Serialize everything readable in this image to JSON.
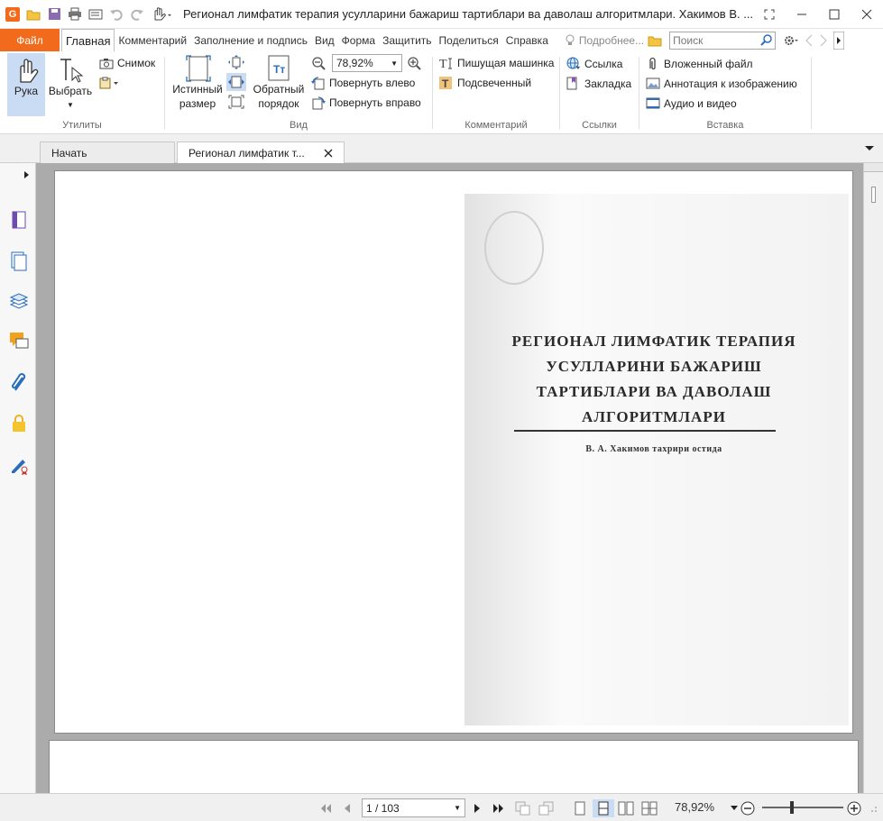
{
  "window": {
    "app_logo": "G",
    "title": "Регионал лимфатик терапия усулларини бажариш тартиблари ва даволаш алгоритмлари. Хакимов В. ..."
  },
  "quick_access": [
    "open-icon",
    "save-icon",
    "print-icon",
    "properties-icon",
    "undo-icon",
    "redo-icon",
    "hand-tool-icon"
  ],
  "menu": {
    "file": "Файл",
    "active_tab": "Главная",
    "items": [
      "Комментарий",
      "Заполнение и подпись",
      "Вид",
      "Форма",
      "Защитить",
      "Поделиться",
      "Справка"
    ],
    "help_text": "Подробнее...",
    "search_placeholder": "Поиск"
  },
  "ribbon": {
    "hand": "Рука",
    "select": "Выбрать",
    "snapshot": "Снимок",
    "group_tools": "Утилиты",
    "actual_size_1": "Истинный",
    "actual_size_2": "размер",
    "reverse_1": "Обратный",
    "reverse_2": "порядок",
    "zoom_value": "78,92%",
    "rotate_left": "Повернуть влево",
    "rotate_right": "Повернуть вправо",
    "group_view": "Вид",
    "typewriter": "Пишущая машинка",
    "highlight": "Подсвеченный",
    "group_comment": "Комментарий",
    "link": "Ссылка",
    "bookmark": "Закладка",
    "group_links": "Ссылки",
    "attach_file": "Вложенный файл",
    "image_annotation": "Аннотация к изображению",
    "audio_video": "Аудио и видео",
    "group_insert": "Вставка"
  },
  "doc_tabs": {
    "start": "Начать",
    "current": "Регионал лимфатик т..."
  },
  "document": {
    "title_lines": [
      "РЕГИОНАЛ ЛИМФАТИК ТЕРАПИЯ",
      "УСУЛЛАРИНИ БАЖАРИШ",
      "ТАРТИБЛАРИ ВА ДАВОЛАШ",
      "АЛГОРИТМЛАРИ"
    ],
    "editor_line": "В. А. Хакимов тахрири остида"
  },
  "status": {
    "page_indicator": "1 / 103",
    "zoom": "78,92%",
    "zoom_level_fraction": 0.36
  }
}
